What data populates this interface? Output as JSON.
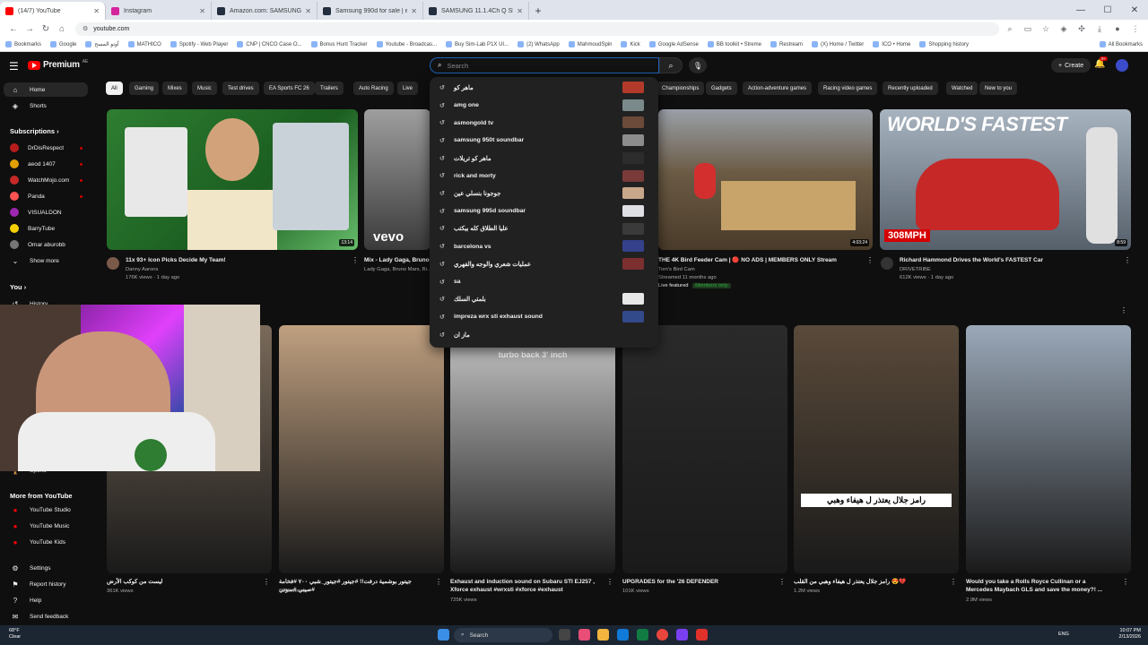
{
  "browser": {
    "tabs": [
      {
        "title": "(14/7) YouTube",
        "favicon_color": "#ff0000"
      },
      {
        "title": "Instagram",
        "favicon_color": "#d6249f"
      },
      {
        "title": "Amazon.com: SAMSUNG Q990",
        "favicon_color": "#232f3e"
      },
      {
        "title": "Samsung 990d for sale | eBay",
        "favicon_color": "#232f3e"
      },
      {
        "title": "SAMSUNG 11.1.4Ch Q SERIES",
        "favicon_color": "#232f3e"
      }
    ],
    "url": "youtube.com",
    "bookmarks": [
      "Bookmarks",
      "Google",
      "أوتو المسح",
      "MATHICO",
      "Spotify - Web Player",
      "CNP | CNCO Case O...",
      "Bonus Hunt Tracker",
      "Youtube - Broadcas...",
      "Buy Sim-Lab P1X UI...",
      "(2) WhatsApp",
      "MahmoudSpin",
      "Kick",
      "Google AdSense",
      "BB toolkit • Streme",
      "Restream",
      "(X) Home / Twitter",
      "ICO • Home",
      "Shopping history"
    ],
    "all_bookmarks": "All Bookmarks"
  },
  "header": {
    "logo_text": "Premium",
    "logo_cc": "AE",
    "search_placeholder": "Search",
    "create_label": "Create",
    "notif_count": "9+"
  },
  "sidebar": {
    "home": "Home",
    "shorts": "Shorts",
    "subscriptions_title": "Subscriptions",
    "subscriptions": [
      {
        "name": "DrDisRespect",
        "color": "#b71c1c"
      },
      {
        "name": "aeod 1407",
        "color": "#e0a000"
      },
      {
        "name": "WatchMojo.com",
        "color": "#c62828"
      },
      {
        "name": "Panda",
        "color": "#ff5252"
      },
      {
        "name": "VISUALDON",
        "color": "#9c27b0"
      },
      {
        "name": "BarryTube",
        "color": "#f5d000"
      },
      {
        "name": "Omar aburobb",
        "color": "#757575"
      }
    ],
    "show_more": "Show more",
    "you_title": "You",
    "history": "History",
    "sports": "Sports",
    "more_title": "More from YouTube",
    "more": [
      "YouTube Studio",
      "YouTube Music",
      "YouTube Kids"
    ],
    "settings": "Settings",
    "report_history": "Report history",
    "help": "Help",
    "send_feedback": "Send feedback"
  },
  "chips": [
    "All",
    "Gaming",
    "Mixes",
    "Music",
    "Test drives",
    "EA Sports FC 26",
    "Trailers",
    "Auto Racing",
    "Live",
    "Championships",
    "Gadgets",
    "Action-adventure games",
    "Racing video games",
    "Recently uploaded",
    "Watched",
    "New to you"
  ],
  "suggestions": [
    {
      "text": "ماهر كو",
      "color": "#b33a2a"
    },
    {
      "text": "amg one",
      "color": "#7a8a8a"
    },
    {
      "text": "asmongold tv",
      "color": "#6b4a3a"
    },
    {
      "text": "samsung 950t soundbar",
      "color": "#8d8d8d"
    },
    {
      "text": "ماهر كو تريلات",
      "color": "#2c2c2c"
    },
    {
      "text": "rick and morty",
      "color": "#7a3a3a"
    },
    {
      "text": "جوجونا بنسلي عين",
      "color": "#c9a78a"
    },
    {
      "text": "samsung 995d soundbar",
      "color": "#dfe0e6"
    },
    {
      "text": "عليا الطلاق كله بيكتب",
      "color": "#3a3a3a"
    },
    {
      "text": "barcelona vs",
      "color": "#35418a"
    },
    {
      "text": "عمليات شعري والوجه والفهري",
      "color": "#7b2f2f"
    },
    {
      "text": "sa",
      "color": ""
    },
    {
      "text": "بلمتي السلك",
      "color": "#e8e8e8"
    },
    {
      "text": "impreza wrx sti exhaust sound",
      "color": "#324a8a"
    },
    {
      "text": "ماز ان",
      "color": ""
    }
  ],
  "videos_top": [
    {
      "title": "11x 93+ Icon Picks Decide My Team!",
      "channel": "Danny Aarons",
      "meta": "176K views · 1 day ago",
      "duration": "13:14",
      "color": "#2e7d32",
      "avatar": "#7a5a4a"
    },
    {
      "title": "Mix - Lady Gaga, Bruno",
      "channel": "Lady Gaga, Bruno Mars, Bi...",
      "meta": "",
      "duration": "",
      "color": "#3a3a3a",
      "avatar": ""
    },
    {
      "title": "THE 4K Bird Feeder Cam | 🔴 NO ADS | MEMBERS ONLY Stream",
      "channel": "Tom's Bird Cam",
      "meta": "Streamed 11 months ago",
      "badge": "Members only",
      "featured": "Live featured",
      "duration": "4:03:24",
      "color": "#6b5b45",
      "avatar": ""
    },
    {
      "title": "Richard Hammond Drives the World's FASTEST Car",
      "channel": "DRIVETRIBE",
      "meta": "612K views · 1 day ago",
      "duration": "8:59",
      "thumb_text": "WORLD'S FASTEST",
      "thumb_sub": "308MPH",
      "color": "#6a7684",
      "avatar": "#333333"
    }
  ],
  "shorts": [
    {
      "title": "ليست من كوكب الأرض",
      "meta": "361K views",
      "color": "#7a6a5a"
    },
    {
      "title": "جيتور بوشمية درفت!! #جيتور #جيتور_شبي ٧٠٠ #فخامة #صيني #سوني",
      "meta": "390K views",
      "color": "#c0a080"
    },
    {
      "title": "Exhaust and induction sound on Subaru STI EJ257 , Xforce exhaust #wrxsti #xforce #exhaust",
      "meta": "725K views",
      "overlay": "turbo back 3' inch",
      "color": "#c9c9c9"
    },
    {
      "title": "UPGRADES for the '26 DEFENDER",
      "meta": "101K views",
      "color": "#2a2a2a"
    },
    {
      "title": "رامز جلال يعتذر ل هيفاء وهبي من القلب 😍💔",
      "meta": "1.2M views",
      "overlay": "رامز جلال يعتذر ل هيفاء وهبي",
      "color": "#5a4a3a"
    },
    {
      "title": "Would you take a Rolls Royce Cullinan or a Mercedes Maybach GLS and save the money?! ...",
      "meta": "2.9M views",
      "color": "#9aa8b8"
    }
  ],
  "taskbar": {
    "temp": "68°F",
    "weather": "Clear",
    "search": "Search",
    "lang": "ENG",
    "time": "10:07 PM",
    "date": "2/13/2026"
  }
}
